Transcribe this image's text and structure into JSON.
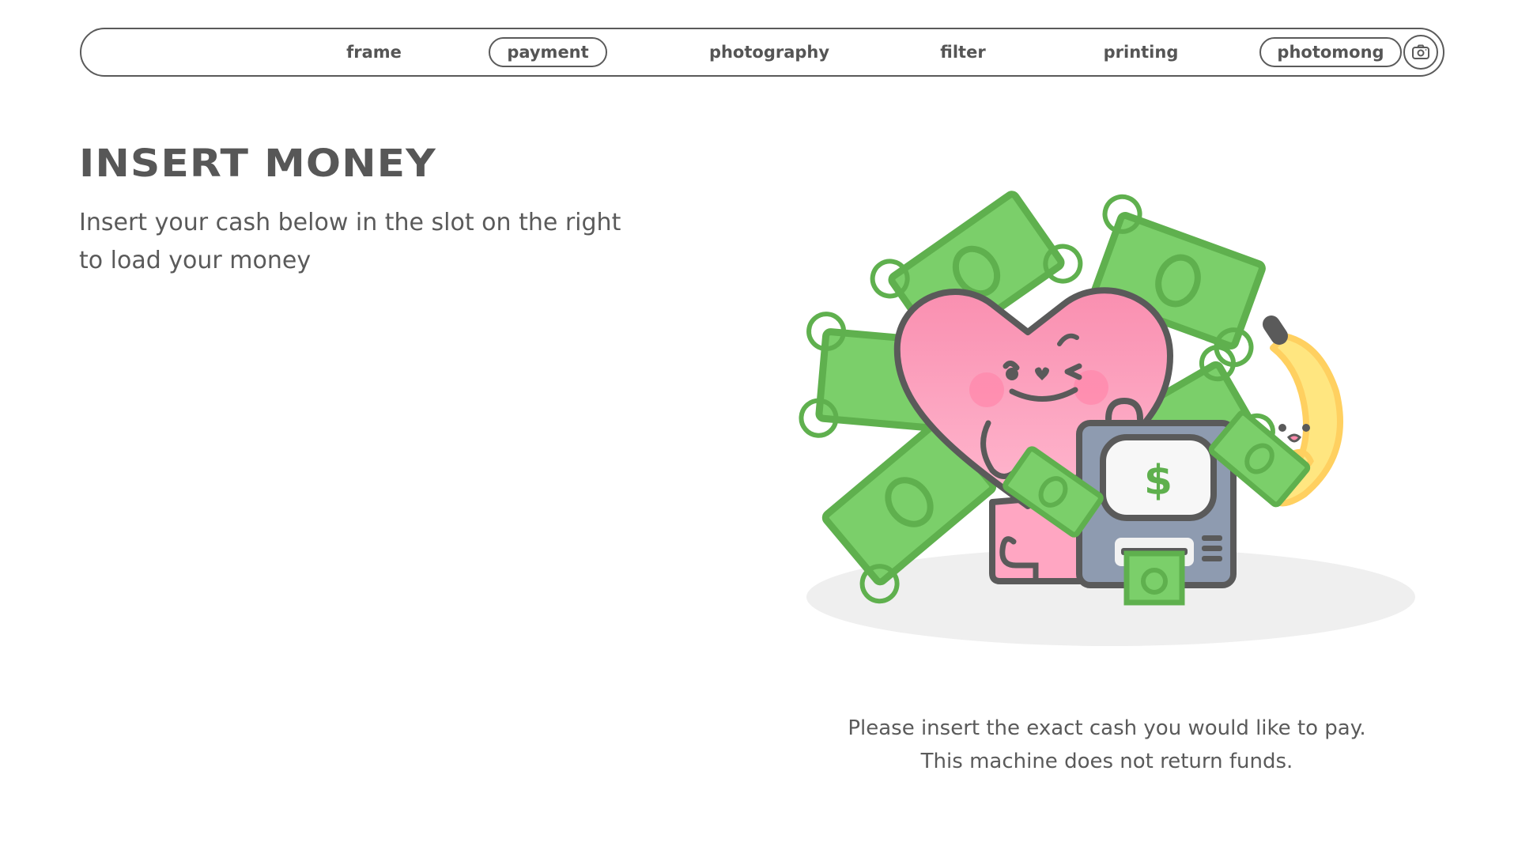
{
  "nav": {
    "items": [
      {
        "label": "frame",
        "active": false
      },
      {
        "label": "payment",
        "active": true
      },
      {
        "label": "photography",
        "active": false
      },
      {
        "label": "filter",
        "active": false
      },
      {
        "label": "printing",
        "active": false
      }
    ],
    "brand": "photomong",
    "camera_icon": "camera-icon"
  },
  "main": {
    "title": "INSERT MONEY",
    "subtitle_line1": "Insert your cash below in the slot on the right",
    "subtitle_line2": "to load your money"
  },
  "illustration": {
    "screen_symbol": "$",
    "colors": {
      "cash_green": "#7bcf6a",
      "cash_border": "#5fb04e",
      "heart_pink": "#f98fb0",
      "machine_gray": "#8e9bb0",
      "banana_yellow": "#ffe680",
      "outline": "#5a5a5a"
    }
  },
  "notice": {
    "line1": "Please insert the exact cash you would like to pay.",
    "line2": "This machine does not return funds."
  }
}
